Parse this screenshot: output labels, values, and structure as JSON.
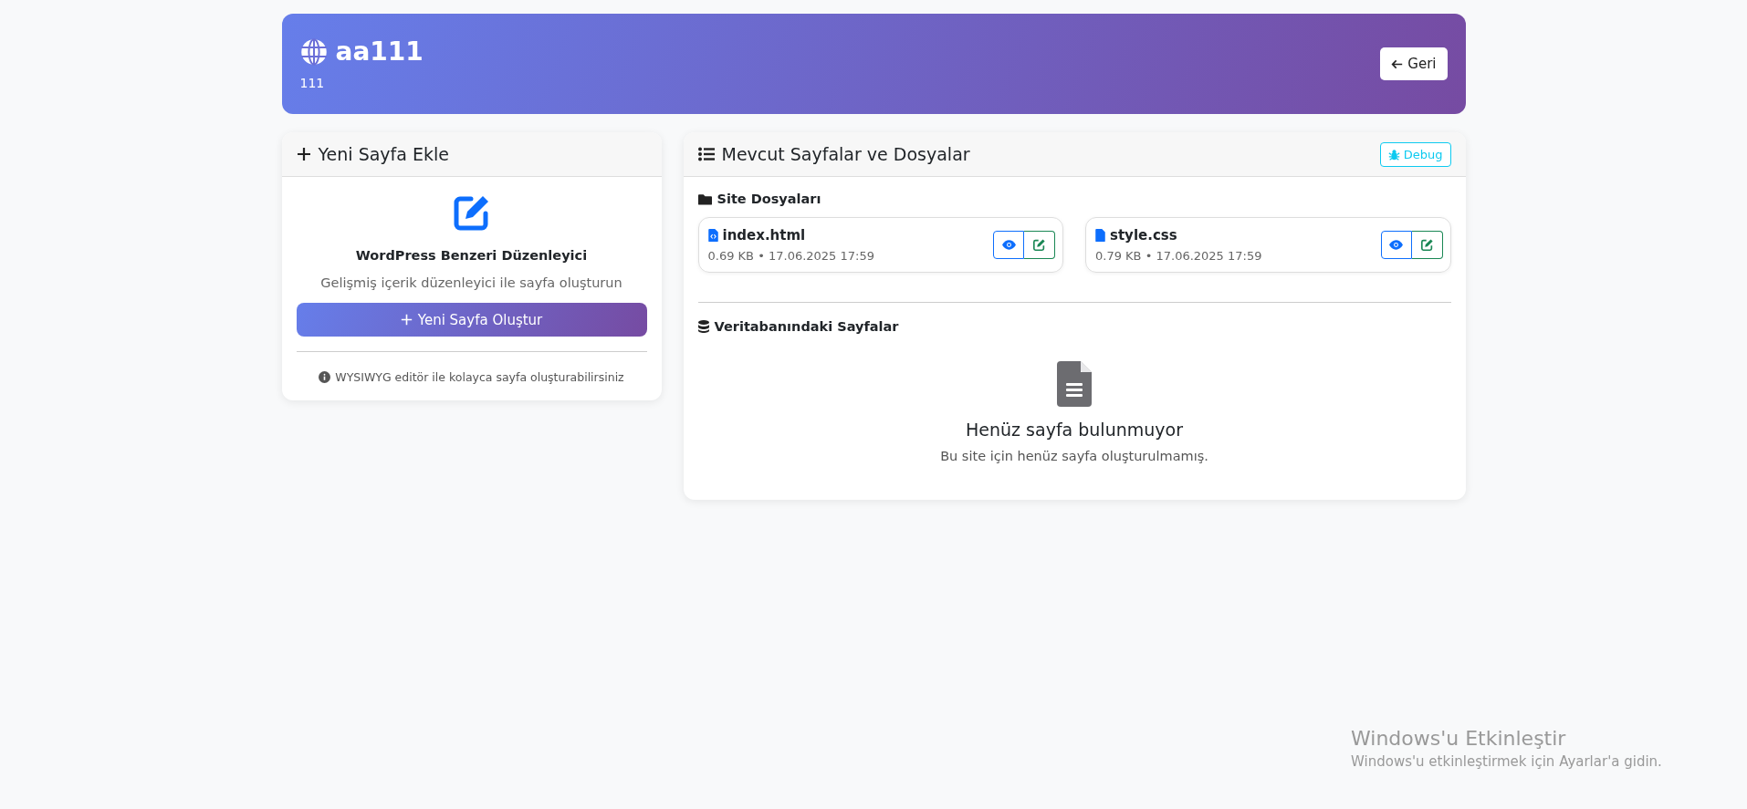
{
  "header": {
    "title": "aa111",
    "subtitle": "111",
    "back_button": "Geri"
  },
  "new_page_card": {
    "title": "Yeni Sayfa Ekle",
    "editor_title": "WordPress Benzeri Düzenleyici",
    "editor_description": "Gelişmiş içerik düzenleyici ile sayfa oluşturun",
    "create_button": "Yeni Sayfa Oluştur",
    "info": "WYSIWYG editör ile kolayca sayfa oluşturabilirsiniz"
  },
  "pages_card": {
    "title": "Mevcut Sayfalar ve Dosyalar",
    "debug_button": "Debug",
    "site_files": {
      "title": "Site Dosyaları",
      "files": [
        {
          "kind": "code",
          "name": "index.html",
          "meta": "0.69 KB • 17.06.2025 17:59"
        },
        {
          "kind": "plain",
          "name": "style.css",
          "meta": "0.79 KB • 17.06.2025 17:59"
        }
      ]
    },
    "db_pages": {
      "title": "Veritabanındaki Sayfalar",
      "empty_title": "Henüz sayfa bulunmuyor",
      "empty_text": "Bu site için henüz sayfa oluşturulmamış."
    }
  },
  "os_notice": {
    "title": "Windows'u Etkinleştir",
    "text": "Windows'u etkinleştirmek için Ayarlar'a gidin."
  }
}
